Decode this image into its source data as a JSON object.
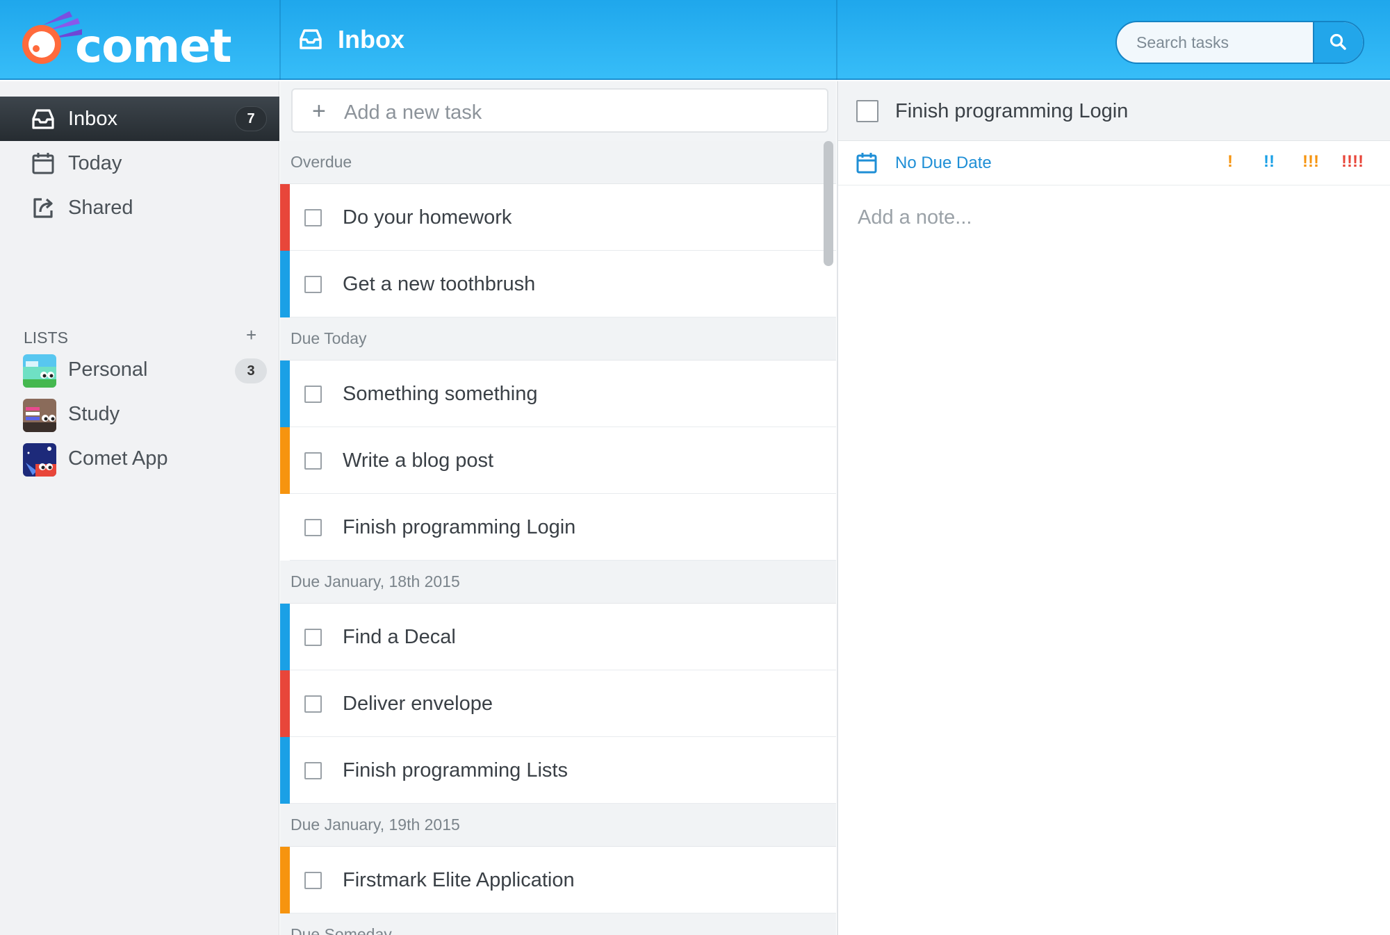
{
  "app": {
    "logo_text": "comet",
    "brand_color": "#1fa7ec"
  },
  "header": {
    "title": "Inbox",
    "icon": "inbox-icon"
  },
  "search": {
    "placeholder": "Search tasks",
    "icon": "search-icon"
  },
  "sidebar": {
    "items": [
      {
        "label": "Inbox",
        "icon": "inbox-icon",
        "badge": "7",
        "active": true
      },
      {
        "label": "Today",
        "icon": "calendar-icon"
      },
      {
        "label": "Shared",
        "icon": "share-icon"
      }
    ],
    "lists_header": "LISTS",
    "lists_add": "+",
    "lists": [
      {
        "label": "Personal",
        "badge": "3"
      },
      {
        "label": "Study"
      },
      {
        "label": "Comet App"
      }
    ]
  },
  "add_task": {
    "placeholder": "Add a new task",
    "icon": "plus-icon"
  },
  "priority_colors": {
    "red": "#e8463a",
    "blue": "#1aa0e6",
    "orange": "#f6940f",
    "none": "#ffffff"
  },
  "groups": [
    {
      "header": "Overdue",
      "tasks": [
        {
          "label": "Do your homework",
          "priority": "red"
        },
        {
          "label": "Get a new toothbrush",
          "priority": "blue"
        }
      ]
    },
    {
      "header": "Due Today",
      "tasks": [
        {
          "label": "Something something",
          "priority": "blue"
        },
        {
          "label": "Write a blog post",
          "priority": "orange"
        },
        {
          "label": "Finish programming Login",
          "priority": "none"
        }
      ]
    },
    {
      "header": "Due January, 18th 2015",
      "tasks": [
        {
          "label": "Find a Decal",
          "priority": "blue"
        },
        {
          "label": "Deliver envelope",
          "priority": "red"
        },
        {
          "label": "Finish programming Lists",
          "priority": "blue"
        }
      ]
    },
    {
      "header": "Due January, 19th 2015",
      "tasks": [
        {
          "label": "Firstmark Elite Application",
          "priority": "orange"
        }
      ]
    },
    {
      "header": "Due Someday",
      "tasks": []
    }
  ],
  "detail": {
    "title": "Finish programming Login",
    "due_label": "No Due Date",
    "priorities": [
      {
        "label": "!",
        "color": "#f6940f"
      },
      {
        "label": "!!",
        "color": "#1aa0e6"
      },
      {
        "label": "!!!",
        "color": "#f6940f"
      },
      {
        "label": "!!!!",
        "color": "#e8463a"
      }
    ],
    "note_placeholder": "Add a note..."
  }
}
